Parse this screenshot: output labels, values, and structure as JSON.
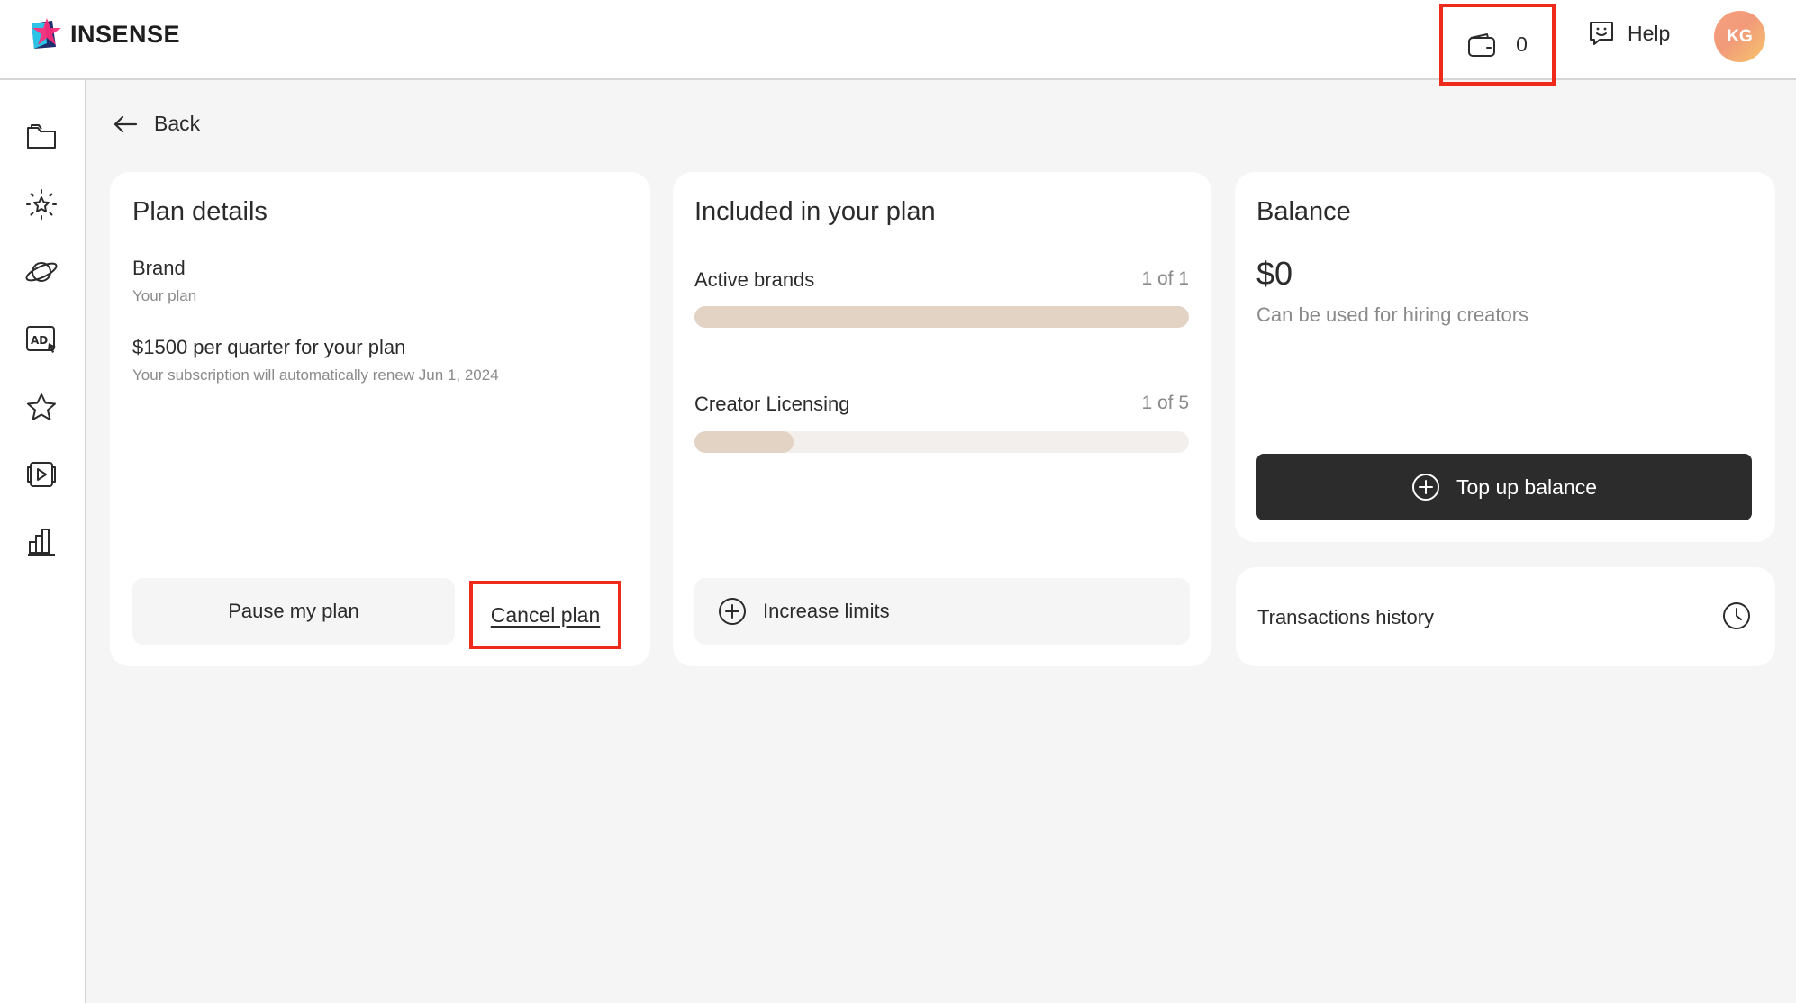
{
  "header": {
    "logo_text": "INSENSE",
    "wallet_count": "0",
    "help_label": "Help",
    "avatar_initials": "KG"
  },
  "sidebar": {
    "items": [
      {
        "icon": "folder-icon"
      },
      {
        "icon": "sparkle-sun-icon"
      },
      {
        "icon": "planet-icon"
      },
      {
        "icon": "ad-icon"
      },
      {
        "icon": "star-icon"
      },
      {
        "icon": "video-play-icon"
      },
      {
        "icon": "bar-chart-icon"
      }
    ]
  },
  "back_label": "Back",
  "plan_details": {
    "title": "Plan details",
    "plan_name": "Brand",
    "plan_caption": "Your plan",
    "price_text": "$1500 per quarter for your plan",
    "renew_text": "Your subscription will automatically renew Jun 1, 2024",
    "pause_label": "Pause my plan",
    "cancel_label": "Cancel plan"
  },
  "included": {
    "title": "Included in your plan",
    "items": [
      {
        "label": "Active brands",
        "count_text": "1 of 1",
        "used": 1,
        "total": 1
      },
      {
        "label": "Creator Licensing",
        "count_text": "1 of 5",
        "used": 1,
        "total": 5
      }
    ],
    "increase_label": "Increase limits"
  },
  "balance": {
    "title": "Balance",
    "amount": "$0",
    "caption": "Can be used for hiring creators",
    "topup_label": "Top up balance"
  },
  "transactions": {
    "label": "Transactions history"
  },
  "colors": {
    "highlight": "#ee2a1b",
    "dark_button": "#2c2c2c",
    "bar_fill": "#e3d3c5",
    "bar_track": "#f3efec"
  }
}
